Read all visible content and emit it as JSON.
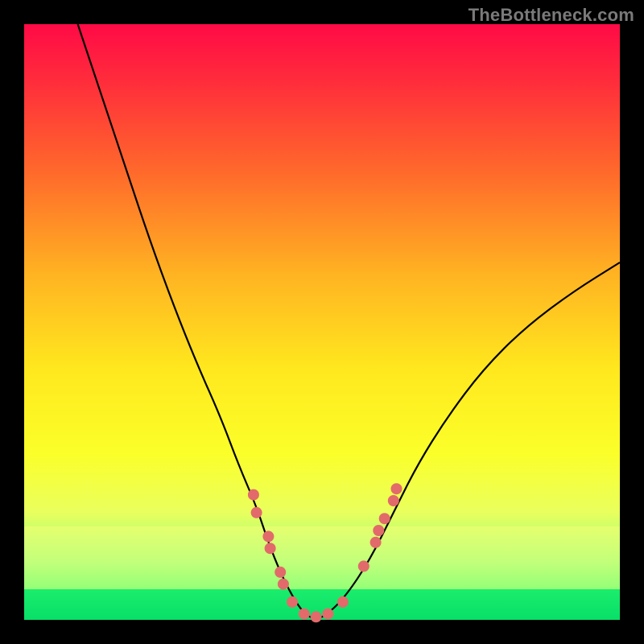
{
  "watermark": "TheBottleneck.com",
  "chart_data": {
    "type": "line",
    "title": "",
    "xlabel": "",
    "ylabel": "",
    "xlim": [
      0,
      100
    ],
    "ylim": [
      0,
      100
    ],
    "grid": false,
    "legend": false,
    "background_gradient": {
      "top": "#ff0a46",
      "middle": "#ffe81e",
      "bottom": "#13e36d"
    },
    "highlight_bands": [
      {
        "name": "acceptable-zone",
        "y0": 5,
        "y1": 16,
        "color": "rgba(255,255,120,0.45)"
      },
      {
        "name": "optimal-zone",
        "y0": 0,
        "y1": 5,
        "color": "rgba(0,220,100,0.55)"
      }
    ],
    "series": [
      {
        "name": "bottleneck-curve",
        "color": "#000000",
        "x": [
          9,
          13,
          17,
          21,
          25,
          29,
          33,
          36,
          39,
          41,
          43,
          45,
          47,
          49,
          51,
          54,
          58,
          62,
          66,
          71,
          77,
          84,
          92,
          100
        ],
        "y": [
          100,
          88,
          76,
          64,
          53,
          43,
          34,
          26,
          19,
          13,
          8,
          4,
          1,
          0,
          1,
          4,
          10,
          18,
          26,
          34,
          42,
          49,
          55,
          60
        ]
      }
    ],
    "marker_groups": [
      {
        "name": "left-markers",
        "color": "#e26a6a",
        "points": [
          {
            "x": 38.5,
            "y": 21
          },
          {
            "x": 39.0,
            "y": 18
          },
          {
            "x": 41.0,
            "y": 14
          },
          {
            "x": 41.3,
            "y": 12
          },
          {
            "x": 43.0,
            "y": 8
          },
          {
            "x": 43.5,
            "y": 6
          },
          {
            "x": 45.0,
            "y": 3
          },
          {
            "x": 47.0,
            "y": 1
          },
          {
            "x": 49.0,
            "y": 0.5
          }
        ]
      },
      {
        "name": "right-markers",
        "color": "#e26a6a",
        "points": [
          {
            "x": 51.0,
            "y": 1
          },
          {
            "x": 53.5,
            "y": 3
          },
          {
            "x": 57.0,
            "y": 9
          },
          {
            "x": 59.0,
            "y": 13
          },
          {
            "x": 59.5,
            "y": 15
          },
          {
            "x": 60.5,
            "y": 17
          },
          {
            "x": 62.0,
            "y": 20
          },
          {
            "x": 62.5,
            "y": 22
          }
        ]
      }
    ]
  }
}
